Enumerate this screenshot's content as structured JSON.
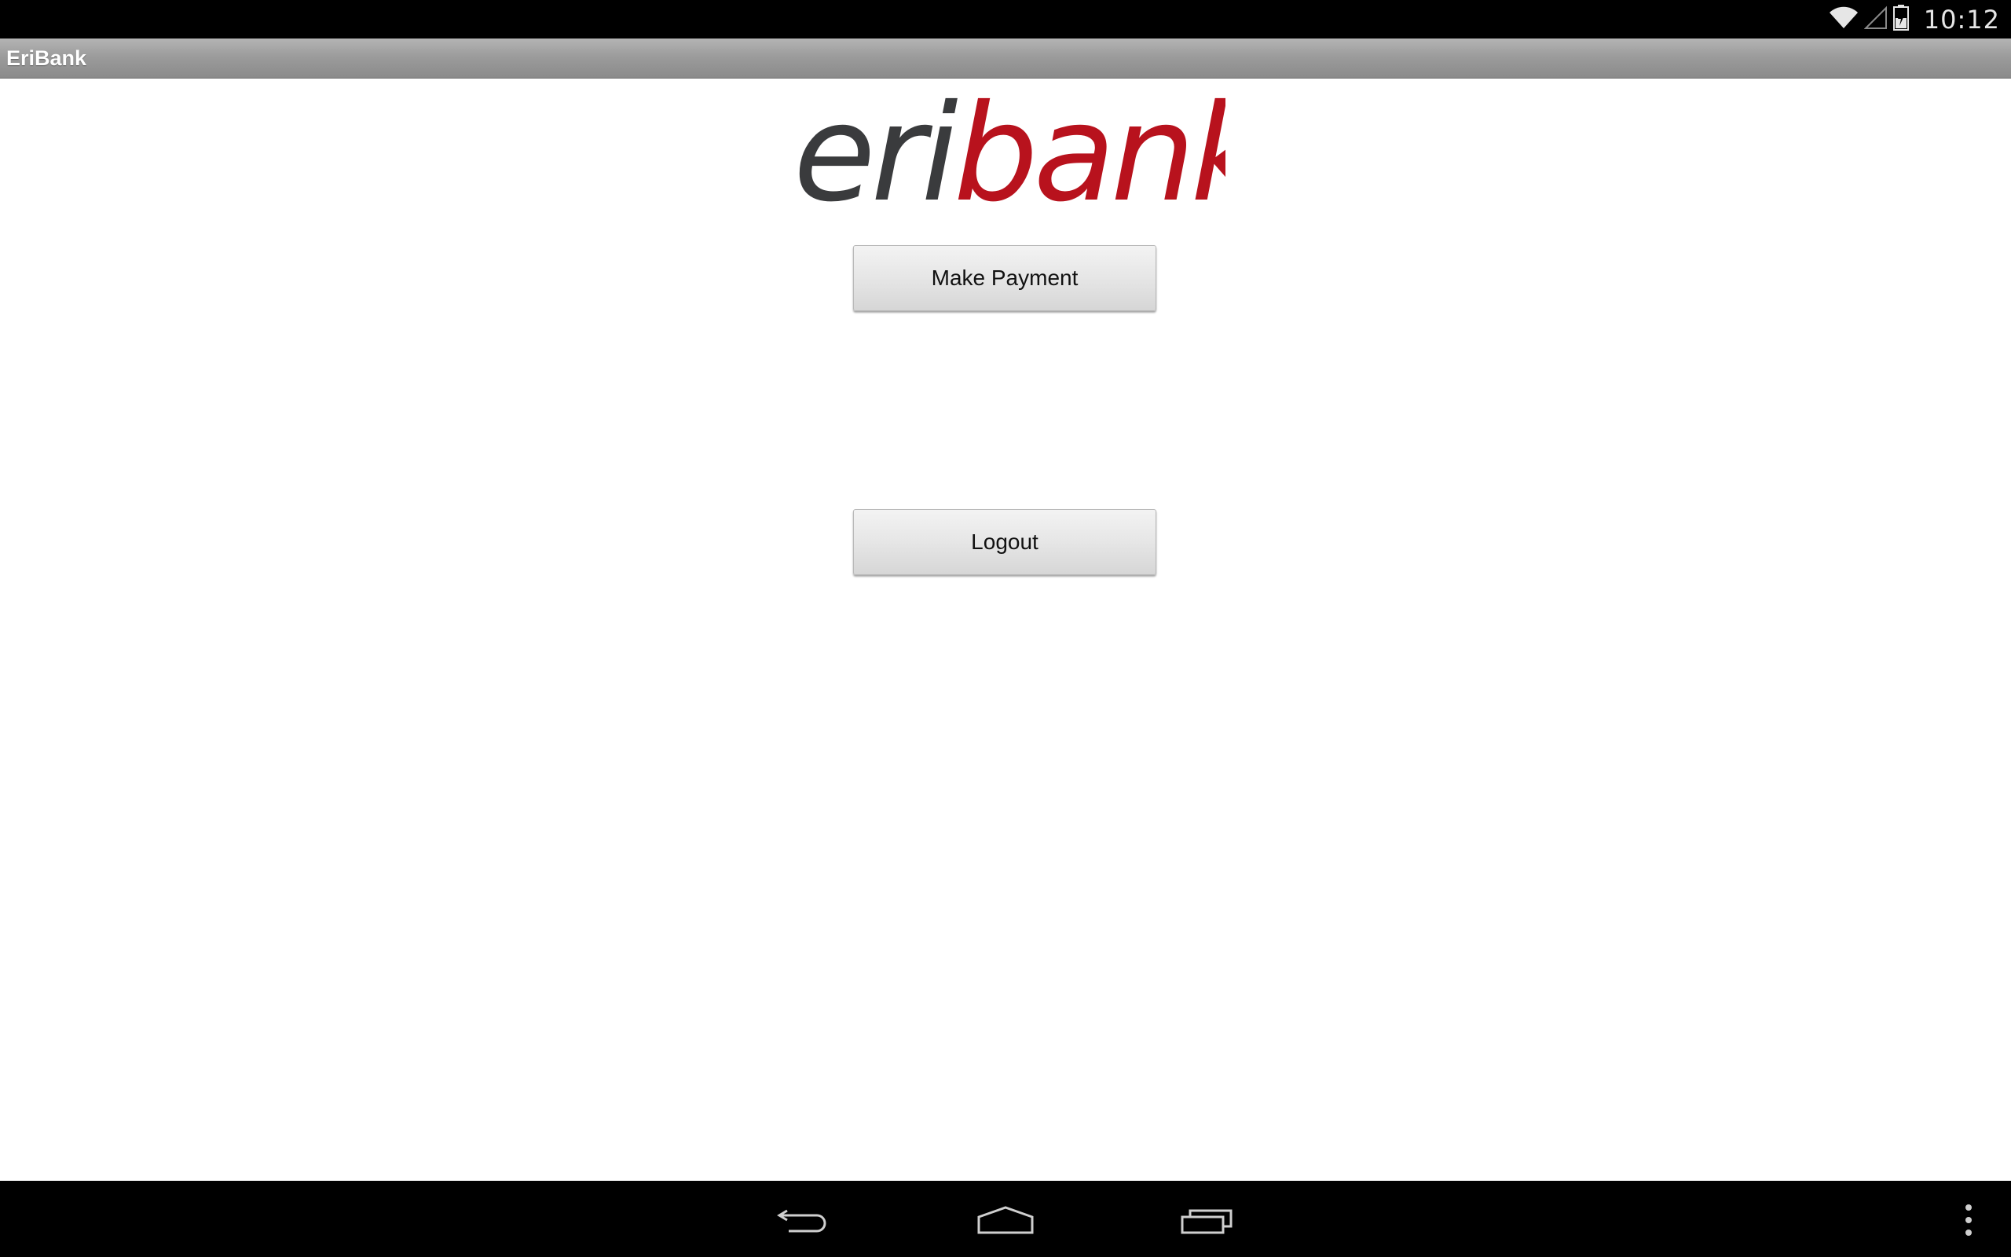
{
  "status_bar": {
    "time": "10:12",
    "icons": [
      "wifi-icon",
      "cell-signal-icon",
      "battery-charging-icon"
    ]
  },
  "title_bar": {
    "app_title": "EriBank"
  },
  "logo": {
    "text_part1": "eri",
    "text_part2": "bank",
    "colors": {
      "part1": "#3a3b3d",
      "part2": "#b8121d"
    }
  },
  "main": {
    "make_payment_label": "Make Payment",
    "logout_label": "Logout"
  },
  "nav_bar": {
    "icons": [
      "back-icon",
      "home-icon",
      "recent-apps-icon",
      "overflow-menu-icon"
    ]
  }
}
